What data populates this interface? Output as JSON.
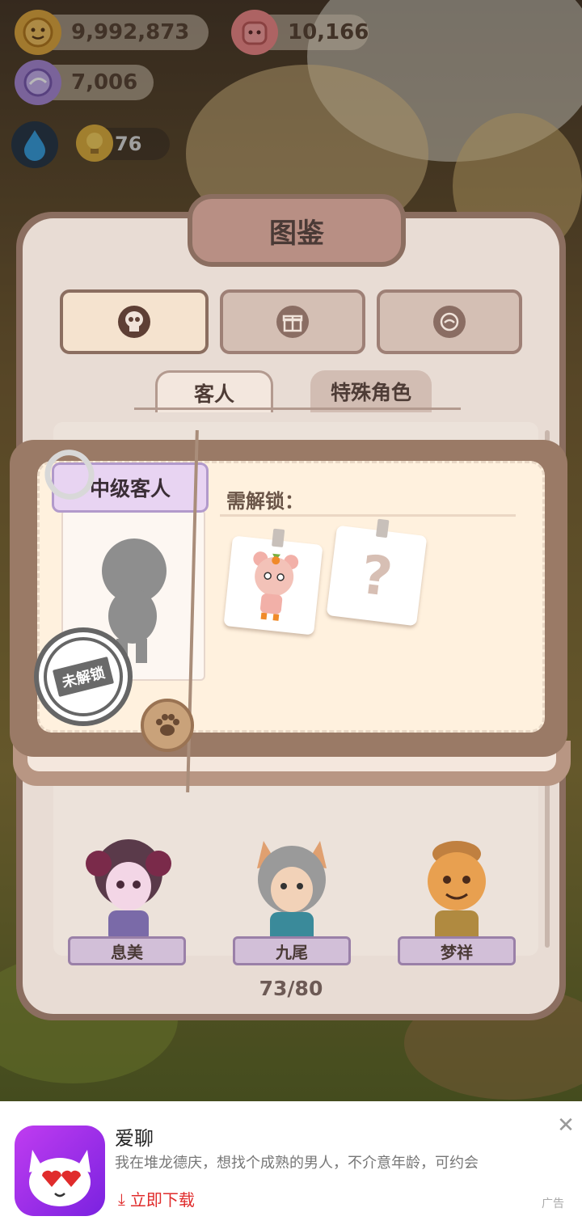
{
  "hud": {
    "coins": "9,992,873",
    "gems": "10,166",
    "candy": "7,006",
    "level": "76"
  },
  "dialog": {
    "title": "图鉴",
    "tabs": [
      {
        "icon": "skull-icon",
        "active": true
      },
      {
        "icon": "gift-icon",
        "active": false
      },
      {
        "icon": "chef-icon",
        "active": false
      }
    ],
    "subtabs": [
      {
        "label": "客人",
        "active": true
      },
      {
        "label": "特殊角色",
        "active": false
      }
    ],
    "characters": [
      {
        "name": "息美"
      },
      {
        "name": "九尾"
      },
      {
        "name": "梦祥"
      }
    ],
    "counter": "73/80"
  },
  "popup": {
    "rank_label": "中级客人",
    "stamp_text": "未解锁",
    "need_label": "需解锁：",
    "requirements": [
      {
        "type": "character"
      },
      {
        "type": "unknown",
        "glyph": "?"
      }
    ]
  },
  "ad": {
    "app_name": "爱聊",
    "description": "我在堆龙德庆，想找个成熟的男人，不介意年龄，可约会",
    "download_label": "立即下载",
    "tag": "广告",
    "close_glyph": "✕",
    "download_glyph": "⤓"
  },
  "colors": {
    "accent_brown": "#8b6e60",
    "popup_bg": "#fff1de",
    "rank_purple": "#e8d4f2",
    "ad_download": "#e02c2c"
  }
}
